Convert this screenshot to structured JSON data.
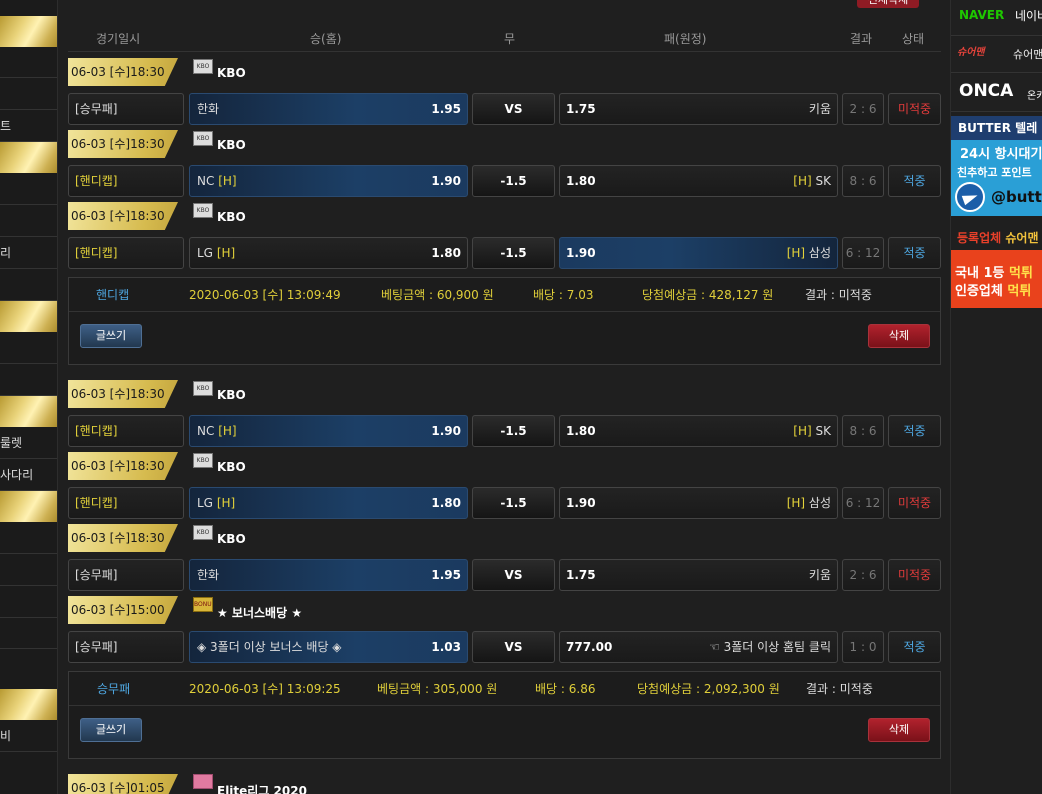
{
  "left_menu": [
    {
      "label": "",
      "gold": true
    },
    {
      "label": "",
      "gold": false
    },
    {
      "label": "",
      "gold": false
    },
    {
      "label": "트",
      "gold": false
    },
    {
      "label": "",
      "gold": true
    },
    {
      "label": "",
      "gold": false
    },
    {
      "label": "",
      "gold": false
    },
    {
      "label": "리",
      "gold": false
    },
    {
      "label": "",
      "gold": false
    },
    {
      "label": "",
      "gold": true
    },
    {
      "label": "",
      "gold": false
    },
    {
      "label": "",
      "gold": false
    },
    {
      "label": "",
      "gold": true
    },
    {
      "label": "룰렛",
      "gold": false
    },
    {
      "label": "사다리",
      "gold": false
    },
    {
      "label": "",
      "gold": true
    },
    {
      "label": "",
      "gold": false
    },
    {
      "label": "",
      "gold": false
    },
    {
      "label": "",
      "gold": false
    },
    {
      "label": "",
      "gold": false
    },
    {
      "label": "",
      "gold": true
    },
    {
      "label": "비",
      "gold": false
    }
  ],
  "top_button": "전체삭제",
  "table_headers": {
    "datetime": "경기일시",
    "home": "승(홈)",
    "draw": "무",
    "away": "패(원정)",
    "result": "결과",
    "status": "상태"
  },
  "bets": [
    {
      "games": [
        {
          "date": "06-03 [수]18:30",
          "league_icon": "KBO",
          "league": "KBO",
          "type": "[승무패]",
          "type_hc": false,
          "home": "한화",
          "home_h": "",
          "home_odd": "1.95",
          "home_sel": true,
          "draw": "VS",
          "away_odd": "1.75",
          "away": "키움",
          "away_h": "",
          "away_sel": false,
          "score": "2 : 6",
          "status": "미적중",
          "status_miss": true
        },
        {
          "date": "06-03 [수]18:30",
          "league_icon": "KBO",
          "league": "KBO",
          "type": "[핸디캡]",
          "type_hc": true,
          "home": "NC",
          "home_h": "[H]",
          "home_odd": "1.90",
          "home_sel": true,
          "draw": "-1.5",
          "away_odd": "1.80",
          "away": "SK",
          "away_h": "[H]",
          "away_sel": false,
          "score": "8 : 6",
          "status": "적중",
          "status_miss": false
        },
        {
          "date": "06-03 [수]18:30",
          "league_icon": "KBO",
          "league": "KBO",
          "type": "[핸디캡]",
          "type_hc": true,
          "home": "LG",
          "home_h": "[H]",
          "home_odd": "1.80",
          "home_sel": false,
          "draw": "-1.5",
          "away_odd": "1.90",
          "away": "삼성",
          "away_h": "[H]",
          "away_sel": true,
          "score": "6 : 12",
          "status": "적중",
          "status_miss": false
        }
      ],
      "summary": {
        "type": "핸디캡",
        "datetime": "2020-06-03 [수] 13:09:49",
        "amount": "베팅금액 : 60,900 원",
        "odds": "배당 : 7.03",
        "expected": "당첨예상금 : 428,127 원",
        "result": "결과 : 미적중"
      },
      "write_label": "글쓰기",
      "delete_label": "삭제"
    },
    {
      "games": [
        {
          "date": "06-03 [수]18:30",
          "league_icon": "KBO",
          "league": "KBO",
          "type": "[핸디캡]",
          "type_hc": true,
          "home": "NC",
          "home_h": "[H]",
          "home_odd": "1.90",
          "home_sel": true,
          "draw": "-1.5",
          "away_odd": "1.80",
          "away": "SK",
          "away_h": "[H]",
          "away_sel": false,
          "score": "8 : 6",
          "status": "적중",
          "status_miss": false
        },
        {
          "date": "06-03 [수]18:30",
          "league_icon": "KBO",
          "league": "KBO",
          "type": "[핸디캡]",
          "type_hc": true,
          "home": "LG",
          "home_h": "[H]",
          "home_odd": "1.80",
          "home_sel": true,
          "draw": "-1.5",
          "away_odd": "1.90",
          "away": "삼성",
          "away_h": "[H]",
          "away_sel": false,
          "score": "6 : 12",
          "status": "미적중",
          "status_miss": true
        },
        {
          "date": "06-03 [수]18:30",
          "league_icon": "KBO",
          "league": "KBO",
          "type": "[승무패]",
          "type_hc": false,
          "home": "한화",
          "home_h": "",
          "home_odd": "1.95",
          "home_sel": true,
          "draw": "VS",
          "away_odd": "1.75",
          "away": "키움",
          "away_h": "",
          "away_sel": false,
          "score": "2 : 6",
          "status": "미적중",
          "status_miss": true
        },
        {
          "date": "06-03 [수]15:00",
          "league_icon": "BONUS",
          "league": "★ 보너스배당 ★",
          "type": "[승무패]",
          "type_hc": false,
          "home": "◈ 3폴더 이상 보너스 배당 ◈",
          "home_h": "",
          "home_odd": "1.03",
          "home_sel": true,
          "draw": "VS",
          "away_odd": "777.00",
          "away": "☜ 3폴더 이상 홈팀 클릭",
          "away_h": "",
          "away_sel": false,
          "score": "1 : 0",
          "status": "적중",
          "status_miss": false
        }
      ],
      "summary": {
        "type": "승무패",
        "datetime": "2020-06-03 [수] 13:09:25",
        "amount": "베팅금액 : 305,000 원",
        "odds": "배당 : 6.86",
        "expected": "당첨예상금 : 2,092,300 원",
        "result": "결과 : 미적중"
      },
      "write_label": "글쓰기",
      "delete_label": "삭제"
    }
  ],
  "next_game": {
    "date": "06-03 [수]01:05",
    "league": "Elite리그 2020"
  },
  "ads": {
    "naver": {
      "brand": "NAVER",
      "text": "네이버"
    },
    "sure": {
      "brand": "슈어맨",
      "text": "슈어맨"
    },
    "onca": {
      "brand": "ONCA",
      "text": "온카"
    },
    "butter": {
      "title": "BUTTER 텔레",
      "line1": "24시 항시대기",
      "line2": "친추하고 포인트",
      "handle": "@butt"
    },
    "registered": {
      "title": "등록업체",
      "title_accent": "슈어맨",
      "line1_a": "국내 1등 ",
      "line1_b": "먹튀",
      "line2_a": "인증업체 ",
      "line2_b": "먹튀"
    }
  }
}
